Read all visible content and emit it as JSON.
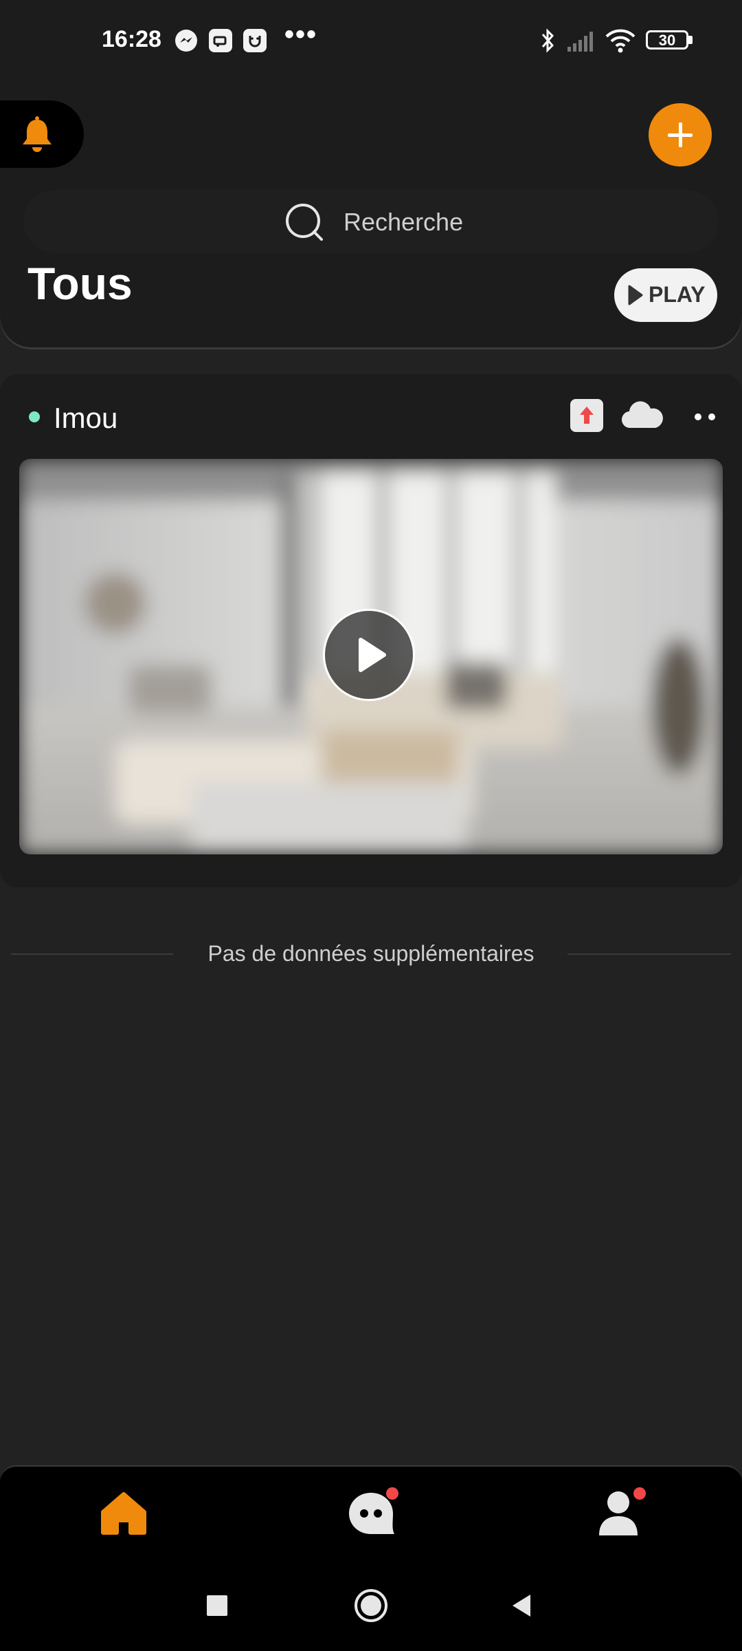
{
  "status_bar": {
    "time": "16:28",
    "battery": "30",
    "notification_icons": [
      "messenger-icon",
      "app-icon",
      "imou-icon"
    ],
    "overflow": "•••"
  },
  "header": {
    "search_placeholder": "Recherche",
    "title": "Tous",
    "play_label": "PLAY",
    "accent_color": "#f08a0c"
  },
  "device": {
    "name": "Imou",
    "online_color": "#7ee8c6"
  },
  "list_footer": {
    "no_more_text": "Pas de données supplémentaires"
  },
  "tabs": [
    {
      "name": "home",
      "active": true
    },
    {
      "name": "messages",
      "badge": true
    },
    {
      "name": "profile",
      "badge": true
    }
  ]
}
